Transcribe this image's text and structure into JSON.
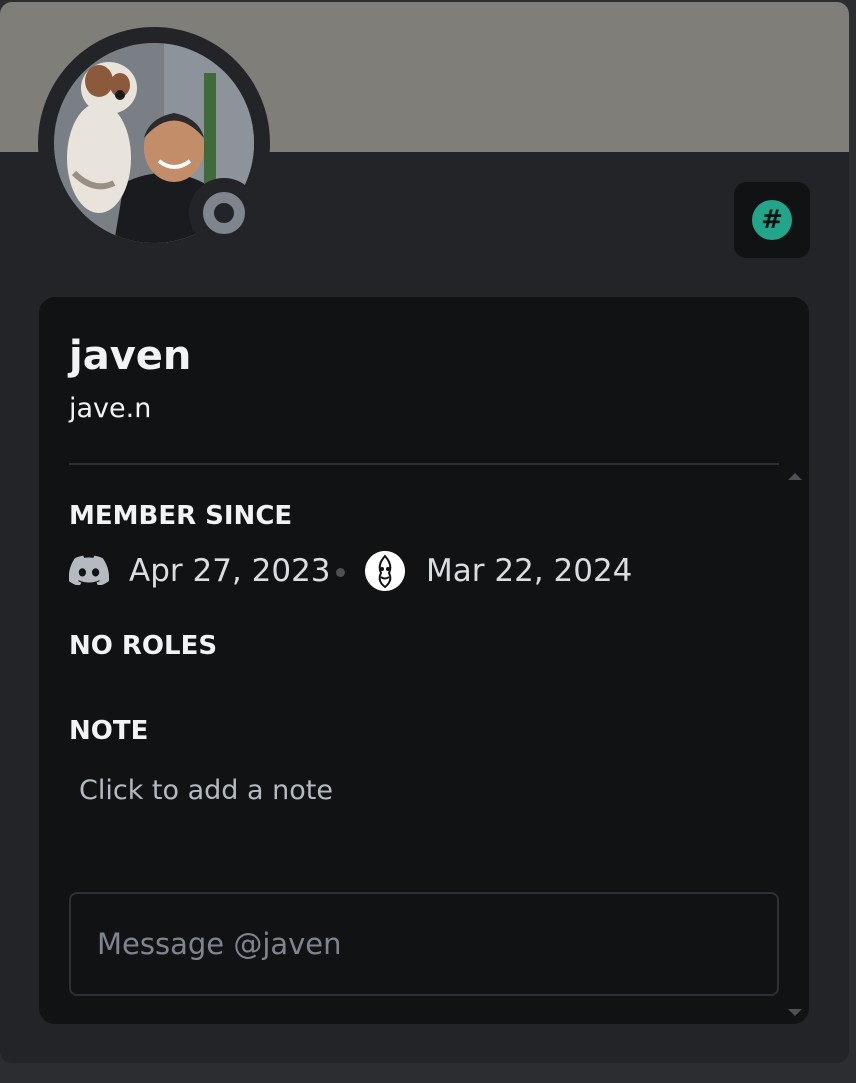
{
  "profile": {
    "display_name": "javen",
    "username": "jave.n",
    "status": "offline",
    "badge_icon": "hashtag-badge-icon",
    "colors": {
      "banner": "#807e79",
      "background": "#232428",
      "card": "#111214",
      "status": "#80848e",
      "badge": "#23a58c"
    }
  },
  "member_since": {
    "title": "MEMBER SINCE",
    "discord_icon": "discord-logo-icon",
    "discord_date": "Apr 27, 2023",
    "server_icon": "server-avatar-icon",
    "server_date": "Mar 22, 2024"
  },
  "roles": {
    "title": "NO ROLES"
  },
  "note": {
    "title": "NOTE",
    "placeholder": "Click to add a note"
  },
  "message": {
    "placeholder": "Message @javen"
  }
}
